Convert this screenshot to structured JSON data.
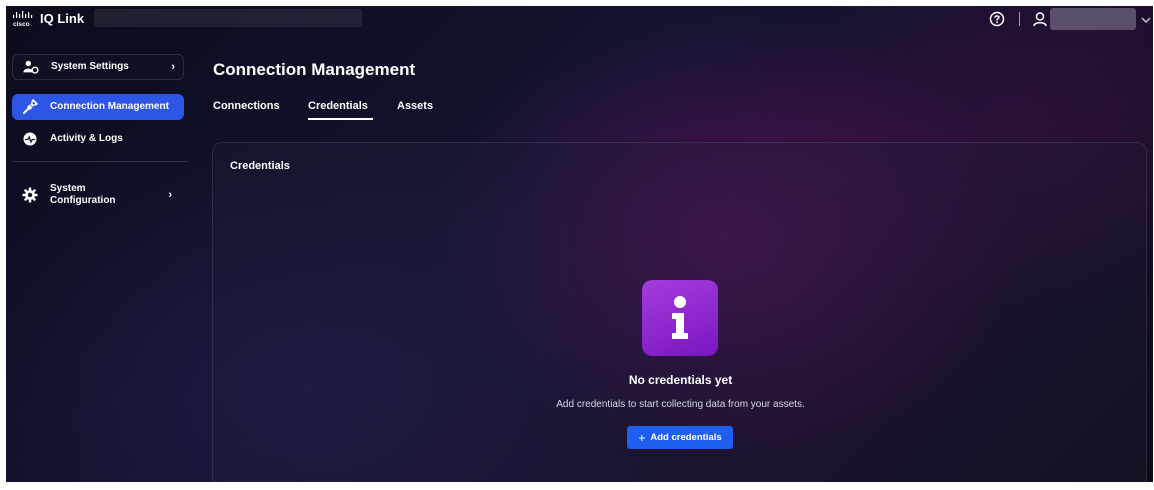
{
  "header": {
    "app_name": "IQ Link",
    "logo_text": "cisco"
  },
  "sidebar": {
    "items": [
      {
        "label": "System Settings",
        "icon": "user-settings-icon",
        "has_chevron": true
      },
      {
        "label": "Connection Management",
        "icon": "plug-icon",
        "active": true
      },
      {
        "label": "Activity & Logs",
        "icon": "activity-icon"
      },
      {
        "label": "System Configuration",
        "icon": "gear-icon",
        "has_chevron": true
      }
    ],
    "chevron": "›"
  },
  "main": {
    "title": "Connection Management",
    "tabs": [
      {
        "label": "Connections"
      },
      {
        "label": "Credentials",
        "active": true
      },
      {
        "label": "Assets"
      }
    ]
  },
  "panel": {
    "title": "Credentials",
    "empty_state": {
      "icon": "info-icon",
      "heading": "No credentials yet",
      "description": "Add credentials to start collecting data from your assets.",
      "button_label": "Add credentials"
    }
  },
  "colors": {
    "accent": "#2d55e6",
    "button": "#1f5ff0",
    "info_tile": "#9b30d9"
  }
}
